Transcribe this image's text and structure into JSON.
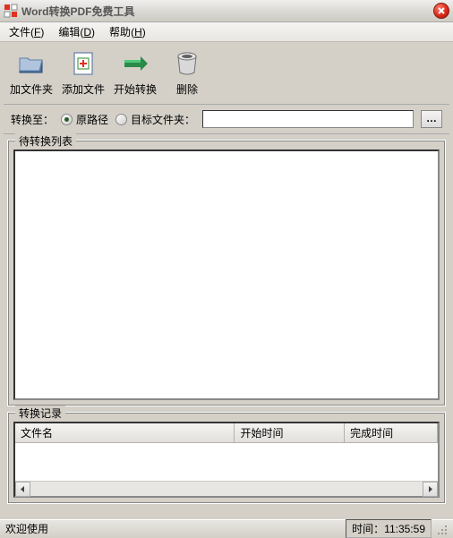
{
  "titlebar": {
    "title": "Word转换PDF免费工具"
  },
  "menubar": {
    "file": "文件",
    "file_key": "F",
    "edit": "编辑",
    "edit_key": "D",
    "help": "帮助",
    "help_key": "H"
  },
  "toolbar": {
    "add_folder": "加文件夹",
    "add_file": "添加文件",
    "start_convert": "开始转换",
    "delete": "删除"
  },
  "dest": {
    "label": "转换至：",
    "option_original": "原路径",
    "option_target": "目标文件夹：",
    "target_value": "",
    "browse": "…"
  },
  "pending_list": {
    "legend": "待转换列表"
  },
  "records": {
    "legend": "转换记录",
    "col_filename": "文件名",
    "col_start": "开始时间",
    "col_end": "完成时间"
  },
  "statusbar": {
    "welcome": "欢迎使用",
    "time_label": "时间：",
    "time_value": "11:35:59"
  }
}
